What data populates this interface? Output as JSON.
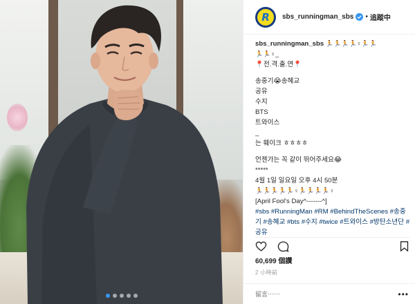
{
  "header": {
    "username": "sbs_runningman_sbs",
    "follow_status": "追蹤中",
    "separator": "•"
  },
  "caption": {
    "username": "sbs_runningman_sbs",
    "line1_emoji": "🏃🏃🏃🏃♀🏃🏃",
    "line2": "🏃🏃♀_",
    "line3": "📍전.격.출.연📍",
    "line4": "송중기😭송혜교",
    "line5": "공유",
    "line6": "수지",
    "line7": "BTS",
    "line8": "트와이스",
    "line9": "_",
    "line10": "는 훼이크 ㅎㅎㅎㅎ",
    "line11": "언젠가는 꼭 같이 뛰어주세요😂",
    "line12": "*****",
    "line13": "4월 1일 일요일 오후 4시 50분",
    "line14": "🏃🏃🏃🏃🏃♀🏃🏃🏃🏃♀",
    "line15": "[April Fool's Day^-------^]",
    "hashtags": "#sbs #RunningMan #RM #BehindTheScenes #송중기 #송혜교 #bts #수지 #twice #트와이스 #방탄소년단 #공유"
  },
  "engagement": {
    "views": "60,699 個讚",
    "time_ago": "2 小時前"
  },
  "comment": {
    "placeholder": "留言⋯⋯",
    "more": "•••"
  },
  "carousel": {
    "count": 5,
    "active_index": 0
  },
  "colors": {
    "accent": "#3897f0",
    "hashtag": "#003569",
    "avatar_outer": "#173a84",
    "avatar_inner": "#f4dc1e"
  },
  "icons": [
    "heart-icon",
    "comment-icon",
    "bookmark-icon",
    "verified-icon",
    "more-icon"
  ]
}
